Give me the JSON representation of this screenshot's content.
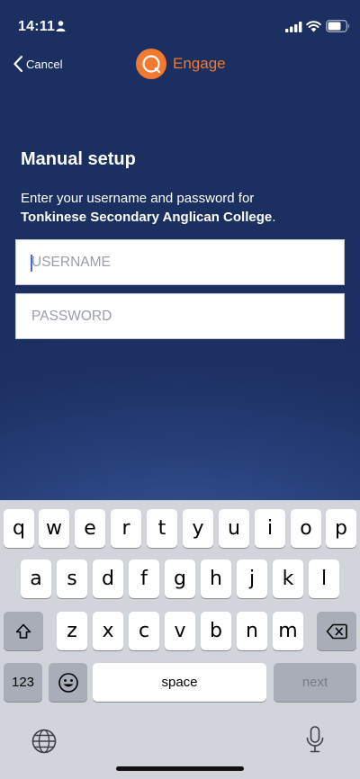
{
  "status_bar": {
    "time": "14:11"
  },
  "nav": {
    "cancel_label": "Cancel",
    "brand_name": "Engage"
  },
  "page": {
    "title": "Manual setup",
    "instructions_prefix": "Enter your username and password for",
    "school_name": "Tonkinese Secondary Anglican College",
    "instructions_suffix": "."
  },
  "form": {
    "username": {
      "placeholder": "USERNAME",
      "value": ""
    },
    "password": {
      "placeholder": "PASSWORD",
      "value": ""
    }
  },
  "keyboard": {
    "row1": [
      "q",
      "w",
      "e",
      "r",
      "t",
      "y",
      "u",
      "i",
      "o",
      "p"
    ],
    "row2": [
      "a",
      "s",
      "d",
      "f",
      "g",
      "h",
      "j",
      "k",
      "l"
    ],
    "row3": [
      "z",
      "x",
      "c",
      "v",
      "b",
      "n",
      "m"
    ],
    "numbers_label": "123",
    "space_label": "space",
    "next_label": "next"
  },
  "colors": {
    "background": "#1e3161",
    "accent": "#f07a30",
    "keyboard": "#d1d4db"
  }
}
